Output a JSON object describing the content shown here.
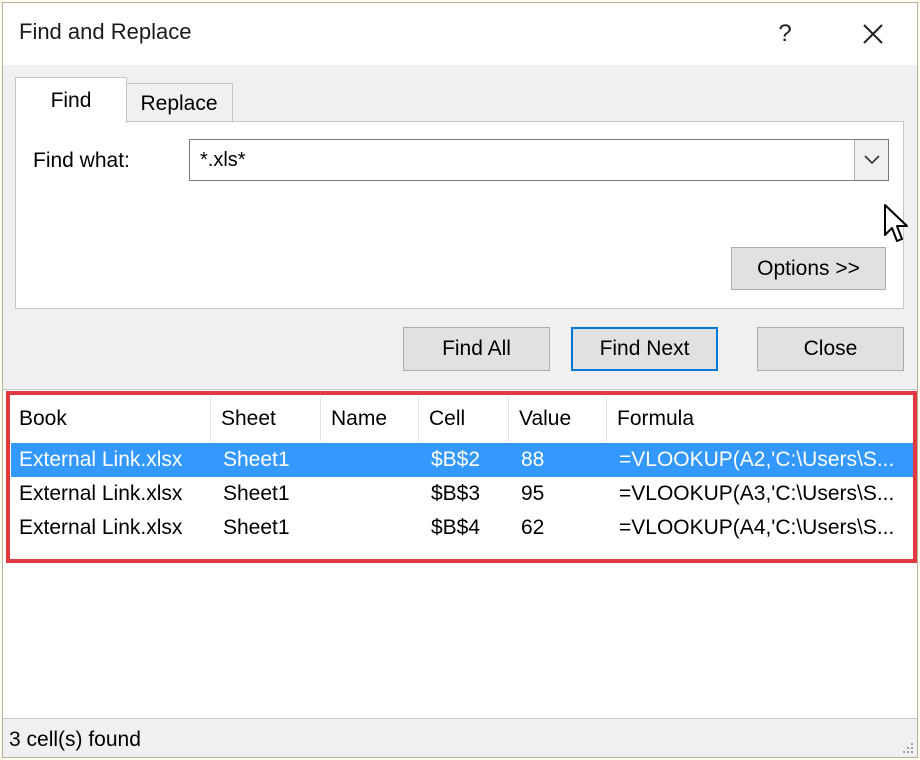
{
  "window": {
    "title": "Find and Replace",
    "help_label": "?"
  },
  "tabs": [
    {
      "label": "Find",
      "active": true
    },
    {
      "label": "Replace",
      "active": false
    }
  ],
  "find": {
    "label": "Find what:",
    "value": "*.xls*"
  },
  "buttons": {
    "options": "Options >>",
    "find_all": "Find All",
    "find_next": "Find Next",
    "close": "Close"
  },
  "results": {
    "columns": [
      "Book",
      "Sheet",
      "Name",
      "Cell",
      "Value",
      "Formula"
    ],
    "rows": [
      {
        "book": "External Link.xlsx",
        "sheet": "Sheet1",
        "name": "",
        "cell": "$B$2",
        "value": "88",
        "formula": "=VLOOKUP(A2,'C:\\Users\\S...",
        "selected": true
      },
      {
        "book": "External Link.xlsx",
        "sheet": "Sheet1",
        "name": "",
        "cell": "$B$3",
        "value": "95",
        "formula": "=VLOOKUP(A3,'C:\\Users\\S...",
        "selected": false
      },
      {
        "book": "External Link.xlsx",
        "sheet": "Sheet1",
        "name": "",
        "cell": "$B$4",
        "value": "62",
        "formula": "=VLOOKUP(A4,'C:\\Users\\S...",
        "selected": false
      }
    ]
  },
  "status": {
    "text": "3 cell(s) found"
  },
  "colors": {
    "selection": "#3399ff",
    "highlight_border": "#e2383f",
    "focus_border": "#0078d7"
  }
}
